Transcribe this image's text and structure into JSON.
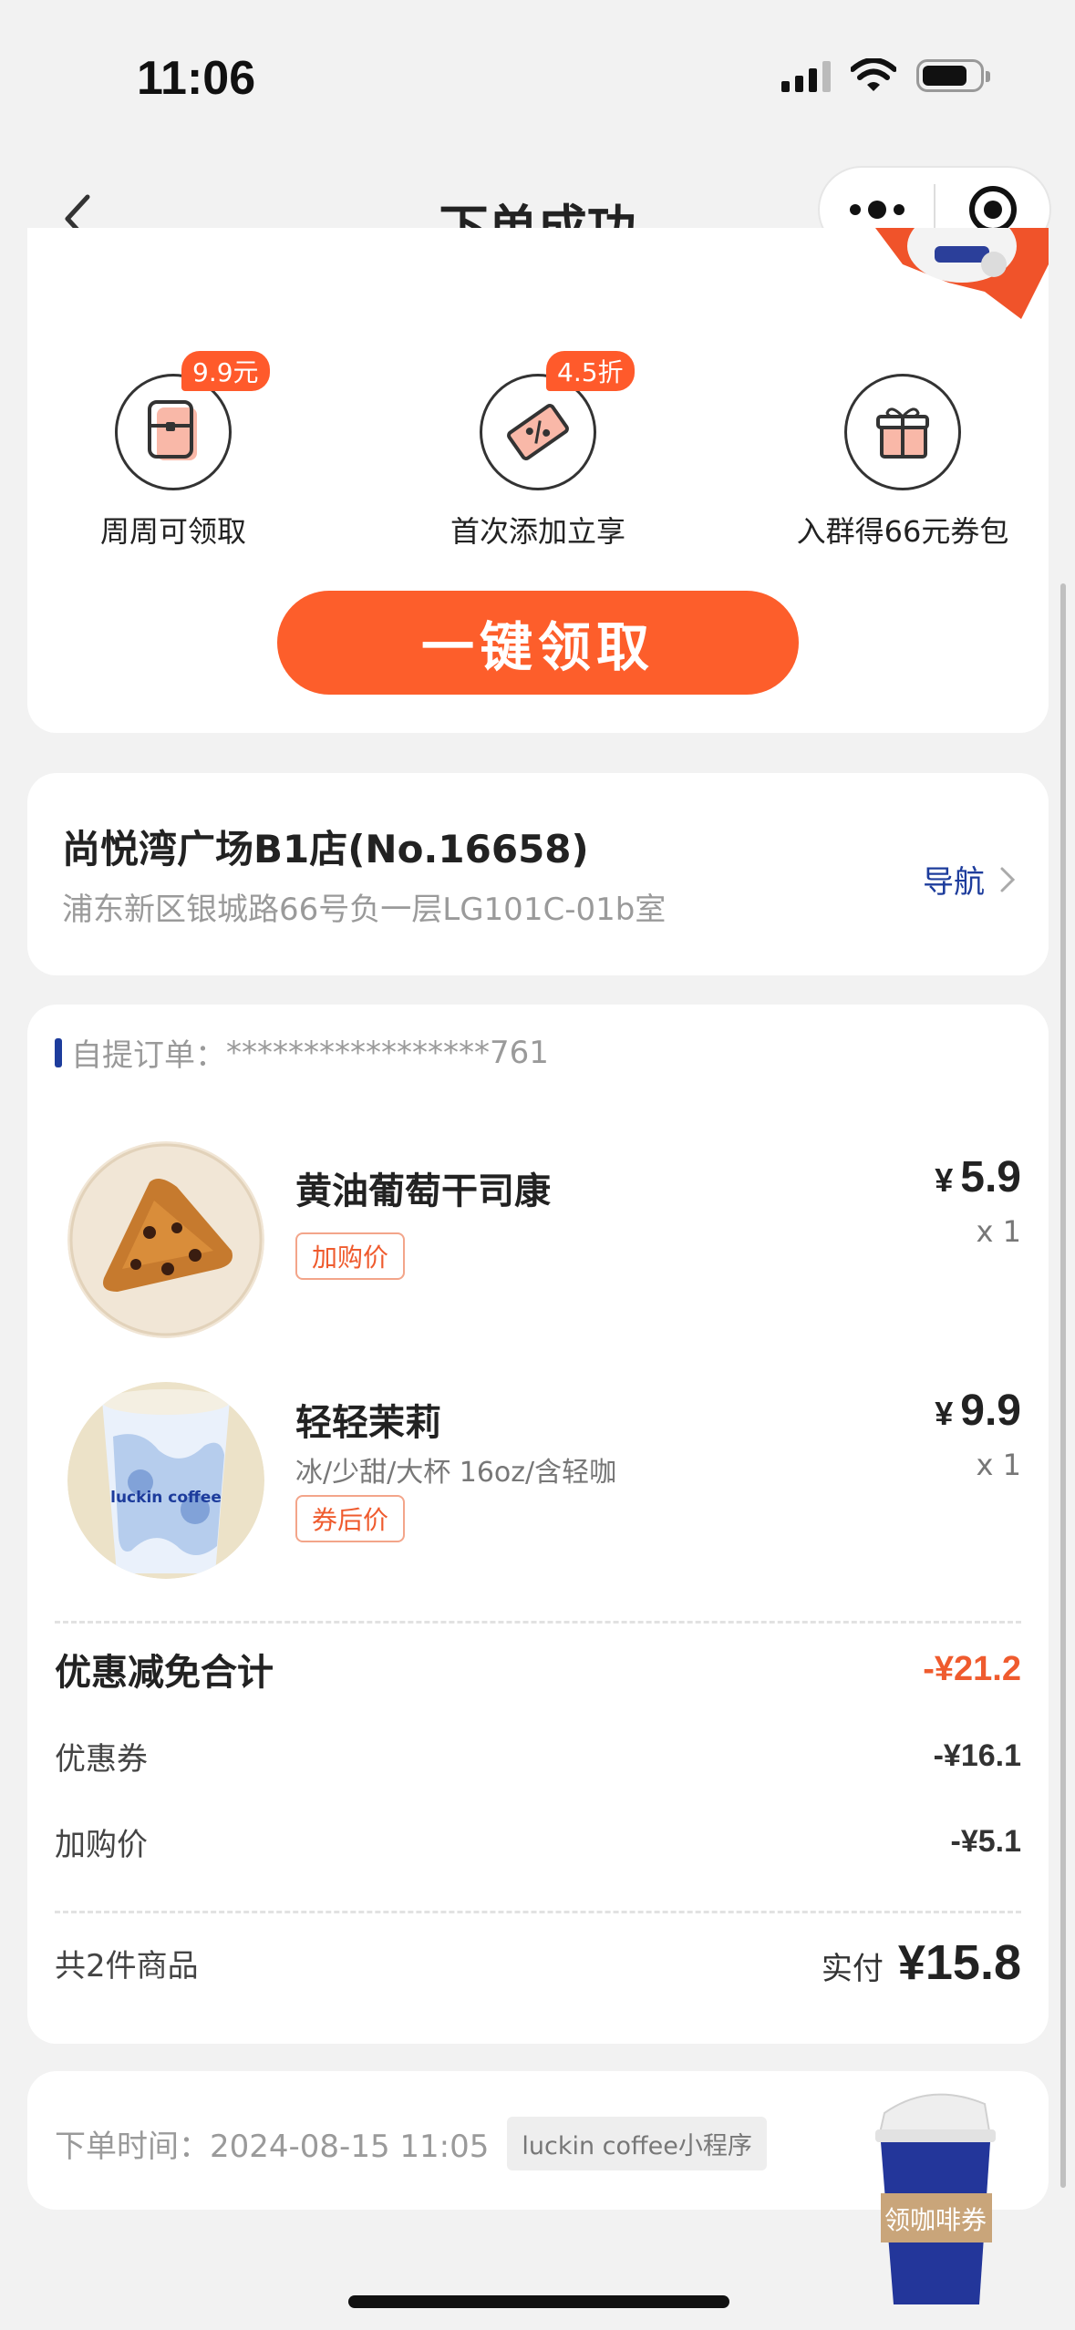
{
  "status_bar": {
    "time": "11:06"
  },
  "nav": {
    "title": "下单成功"
  },
  "promo": {
    "perks": [
      {
        "tag": "9.9元",
        "label": "周周可领取",
        "icon": "coupon-card-icon"
      },
      {
        "tag": "4.5折",
        "label": "首次添加立享",
        "icon": "discount-ticket-icon"
      },
      {
        "tag": "",
        "label": "入群得66元券包",
        "icon": "gift-icon"
      }
    ],
    "claim_button": "一键领取"
  },
  "store": {
    "name": "尚悦湾广场B1店(No.16658)",
    "address": "浦东新区银城路66号负一层LG101C-01b室",
    "nav_label": "导航"
  },
  "order": {
    "order_no_label": "自提订单：",
    "order_no_value": "*****************761",
    "items": [
      {
        "name": "黄油葡萄干司康",
        "spec": "",
        "tag": "加购价",
        "currency": "¥",
        "price": "5.9",
        "qty": "x 1"
      },
      {
        "name": "轻轻茉莉",
        "spec": "冰/少甜/大杯 16oz/含轻咖",
        "tag": "券后价",
        "currency": "¥",
        "price": "9.9",
        "qty": "x 1"
      }
    ],
    "discount_total_label": "优惠减免合计",
    "discount_total_value": "-¥21.2",
    "discount_lines": [
      {
        "label": "优惠券",
        "value": "-¥16.1"
      },
      {
        "label": "加购价",
        "value": "-¥5.1"
      }
    ],
    "item_count": "共2件商品",
    "paid_label": "实付",
    "paid_value": "¥15.8"
  },
  "order_time": {
    "label": "下单时间：",
    "value": "2024-08-15 11:05",
    "source_chip": "luckin coffee小程序"
  },
  "float_cup": {
    "label": "领咖啡券"
  },
  "colors": {
    "accent": "#fd5e2b",
    "brand_blue": "#1d3c9c",
    "bg": "#f2f2f2"
  }
}
